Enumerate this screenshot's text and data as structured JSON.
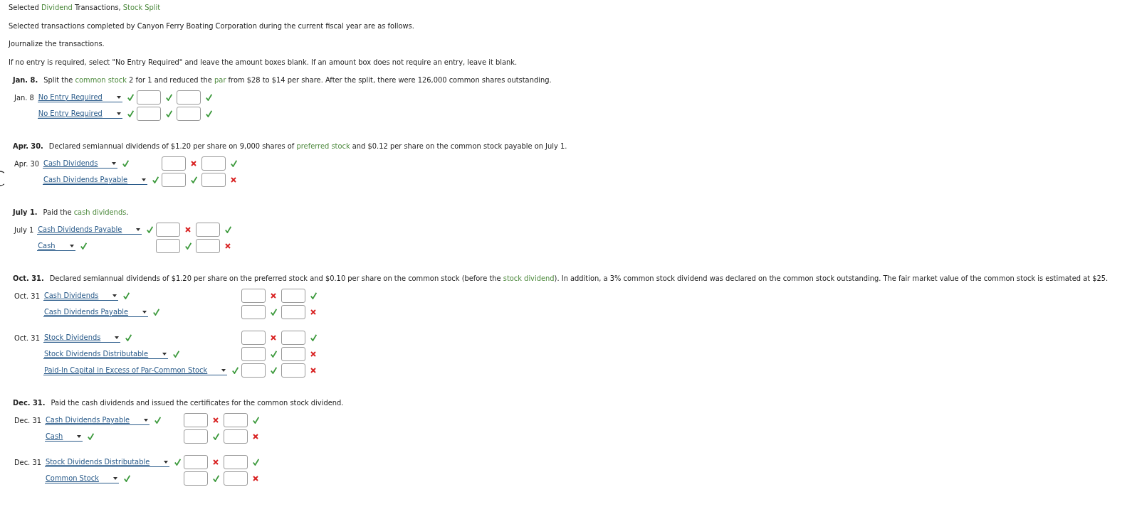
{
  "title": [
    {
      "kind": "text",
      "text": "Selected "
    },
    {
      "kind": "term",
      "text": "Dividend"
    },
    {
      "kind": "text",
      "text": " Transactions, "
    },
    {
      "kind": "term",
      "text": "Stock Split"
    }
  ],
  "paragraphs": [
    "Selected transactions completed by Canyon Ferry Boating Corporation during the current fiscal year are as follows.",
    "Journalize the transactions.",
    "If no entry is required, select \"No Entry Required\" and leave the amount boxes blank. If an amount box does not require an entry, leave it blank."
  ],
  "transactions": [
    {
      "date_label": "Jan. 8.",
      "description": [
        {
          "kind": "text",
          "text": "Split the "
        },
        {
          "kind": "term",
          "text": "common stock"
        },
        {
          "kind": "text",
          "text": " 2 for 1 and reduced the "
        },
        {
          "kind": "term",
          "text": "par"
        },
        {
          "kind": "text",
          "text": " from $28 to $14 per share. After the split, there were 126,000 common shares outstanding."
        }
      ],
      "entries": [
        {
          "lines": [
            {
              "date": "Jan. 8",
              "account": "No Entry Required",
              "account_correct": true,
              "debit_correct": true,
              "credit_correct": true
            },
            {
              "account": "No Entry Required",
              "account_correct": true,
              "debit_correct": true,
              "credit_correct": true
            }
          ]
        }
      ]
    },
    {
      "date_label": "Apr. 30.",
      "description": [
        {
          "kind": "text",
          "text": "Declared semiannual dividends of $1.20 per share on 9,000 shares of "
        },
        {
          "kind": "term",
          "text": "preferred stock"
        },
        {
          "kind": "text",
          "text": " and $0.12 per share on the common stock payable on July 1."
        }
      ],
      "entries": [
        {
          "lines": [
            {
              "date": "Apr. 30",
              "account": "Cash Dividends",
              "account_correct": true,
              "debit_correct": false,
              "credit_correct": true
            },
            {
              "account": "Cash Dividends Payable",
              "account_correct": true,
              "debit_correct": true,
              "credit_correct": false
            }
          ]
        }
      ]
    },
    {
      "date_label": "July 1.",
      "description": [
        {
          "kind": "text",
          "text": "Paid the "
        },
        {
          "kind": "term",
          "text": "cash dividends"
        },
        {
          "kind": "text",
          "text": "."
        }
      ],
      "entries": [
        {
          "lines": [
            {
              "date": "July 1",
              "account": "Cash Dividends Payable",
              "account_correct": true,
              "debit_correct": false,
              "credit_correct": true
            },
            {
              "account": "Cash",
              "account_correct": true,
              "debit_correct": true,
              "credit_correct": false
            }
          ]
        }
      ]
    },
    {
      "date_label": "Oct. 31.",
      "description": [
        {
          "kind": "text",
          "text": "Declared semiannual dividends of $1.20 per share on the preferred stock and $0.10 per share on the common stock (before the "
        },
        {
          "kind": "term",
          "text": "stock dividend"
        },
        {
          "kind": "text",
          "text": "). In addition, a 3% common stock dividend was declared on the common stock outstanding. The fair market value of the common stock is estimated at $25."
        }
      ],
      "entries": [
        {
          "lines": [
            {
              "date": "Oct. 31",
              "account": "Cash Dividends",
              "account_correct": true,
              "debit_correct": false,
              "credit_correct": true
            },
            {
              "account": "Cash Dividends Payable",
              "account_correct": true,
              "debit_correct": true,
              "credit_correct": false
            }
          ]
        },
        {
          "lines": [
            {
              "date": "Oct. 31",
              "account": "Stock Dividends",
              "account_correct": true,
              "debit_correct": false,
              "credit_correct": true
            },
            {
              "account": "Stock Dividends Distributable",
              "account_correct": true,
              "debit_correct": true,
              "credit_correct": false
            },
            {
              "account": "Paid-In Capital in Excess of Par-Common Stock",
              "account_correct": true,
              "debit_correct": true,
              "credit_correct": false
            }
          ]
        }
      ]
    },
    {
      "date_label": "Dec. 31.",
      "description": [
        {
          "kind": "text",
          "text": "Paid the cash dividends and issued the certificates for the common stock dividend."
        }
      ],
      "entries": [
        {
          "lines": [
            {
              "date": "Dec. 31",
              "account": "Cash Dividends Payable",
              "account_correct": true,
              "debit_correct": false,
              "credit_correct": true
            },
            {
              "account": "Cash",
              "account_correct": true,
              "debit_correct": true,
              "credit_correct": false
            }
          ]
        },
        {
          "lines": [
            {
              "date": "Dec. 31",
              "account": "Stock Dividends Distributable",
              "account_correct": true,
              "debit_correct": false,
              "credit_correct": true
            },
            {
              "account": "Common Stock",
              "account_correct": true,
              "debit_correct": true,
              "credit_correct": false
            }
          ]
        }
      ]
    }
  ]
}
